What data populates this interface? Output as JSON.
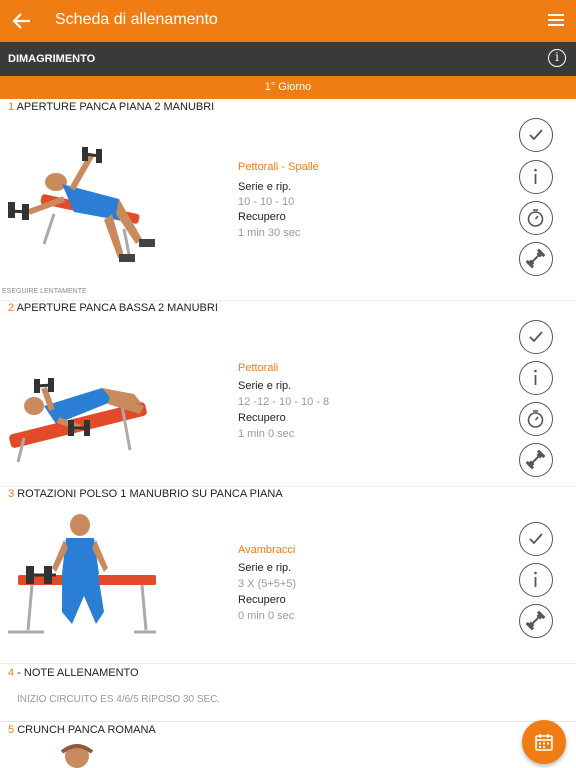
{
  "appbar": {
    "title": "Scheda di allenamento",
    "back_icon": "arrow-left-icon",
    "menu_icon": "hamburger-menu-icon"
  },
  "program": {
    "name": "DIMAGRIMENTO",
    "info_icon": "info-icon"
  },
  "day": {
    "label": "1° Giorno"
  },
  "colors": {
    "accent": "#f07d13",
    "dark_bar": "#3a3a3a",
    "muted": "#999999"
  },
  "exercises": [
    {
      "number": "1",
      "name": "APERTURE PANCA PIANA 2 MANUBRI",
      "muscle": "Pettorali - Spalle",
      "sets_label": "Serie e rip.",
      "sets": "10 - 10 - 10",
      "rest_label": "Recupero",
      "rest": "1 min 30 sec",
      "note": "ESEGUIRE LENTAMENTE"
    },
    {
      "number": "2",
      "name": "APERTURE PANCA BASSA 2 MANUBRI",
      "muscle": "Pettorali",
      "sets_label": "Serie e rip.",
      "sets": "12 -12 - 10 - 10 - 8",
      "rest_label": "Recupero",
      "rest": "1 min 0 sec"
    },
    {
      "number": "3",
      "name": "ROTAZIONI POLSO 1 MANUBRIO SU PANCA PIANA",
      "muscle": "Avambracci",
      "sets_label": "Serie e rip.",
      "sets": "3 X (5+5+5)",
      "rest_label": "Recupero",
      "rest": "0 min 0 sec"
    },
    {
      "number": "5",
      "name": "CRUNCH PANCA ROMANA"
    }
  ],
  "notes": {
    "number": "4",
    "title": " - NOTE ALLENAMENTO",
    "text": "INIZIO CIRCUITO ES 4/6/5 RIPOSO 30 SEC."
  },
  "fab": {
    "icon": "calendar-icon"
  }
}
